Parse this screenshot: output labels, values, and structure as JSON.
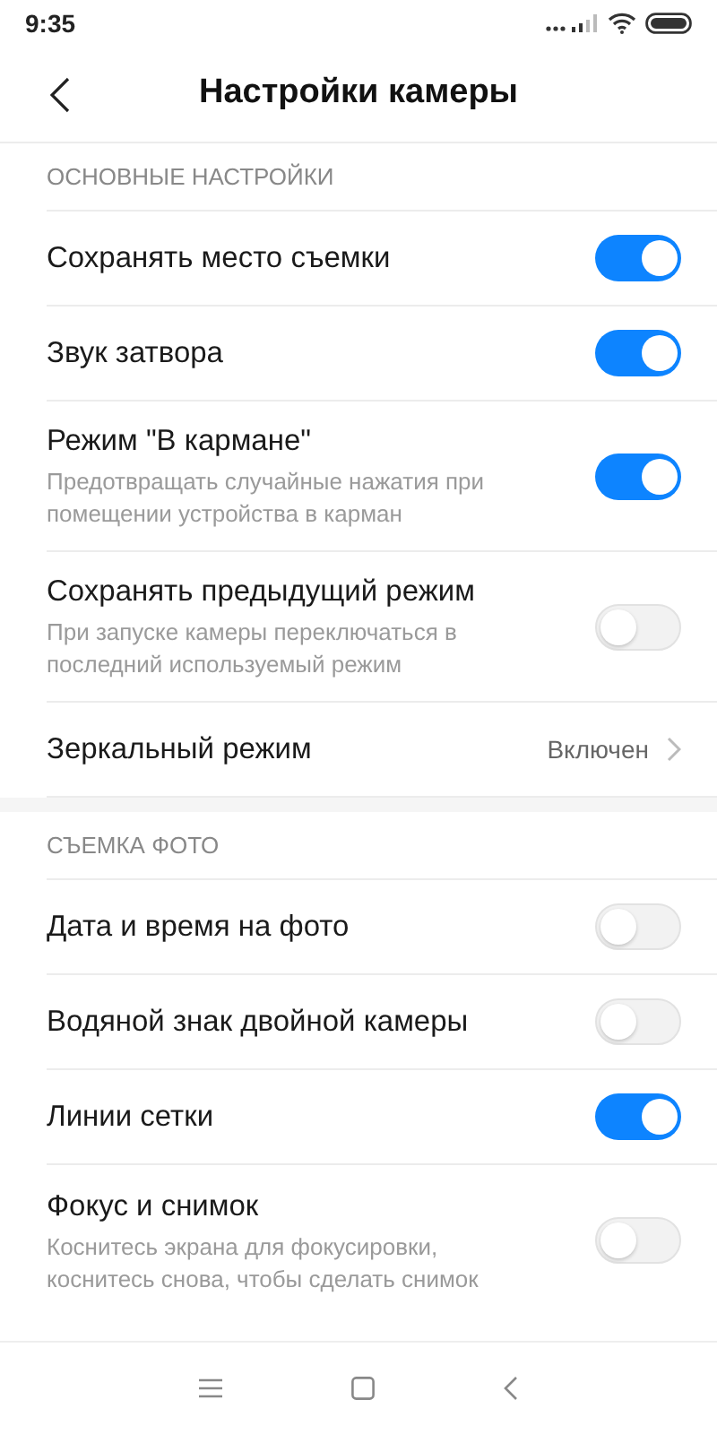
{
  "status_bar": {
    "time": "9:35"
  },
  "header": {
    "title": "Настройки камеры"
  },
  "sections": [
    {
      "title": "ОСНОВНЫЕ НАСТРОЙКИ",
      "items": [
        {
          "kind": "toggle",
          "label": "Сохранять место съемки",
          "on": true
        },
        {
          "kind": "toggle",
          "label": "Звук затвора",
          "on": true
        },
        {
          "kind": "toggle",
          "label": "Режим \"В кармане\"",
          "description": "Предотвращать случайные нажатия при помещении устройства в карман",
          "on": true
        },
        {
          "kind": "toggle",
          "label": "Сохранять предыдущий режим",
          "description": "При запуске камеры переключаться в последний используемый режим",
          "on": false
        },
        {
          "kind": "link",
          "label": "Зеркальный режим",
          "value": "Включен"
        }
      ]
    },
    {
      "title": "СЪЕМКА ФОТО",
      "items": [
        {
          "kind": "toggle",
          "label": "Дата и время на фото",
          "on": false
        },
        {
          "kind": "toggle",
          "label": "Водяной знак двойной камеры",
          "on": false
        },
        {
          "kind": "toggle",
          "label": "Линии сетки",
          "on": true
        },
        {
          "kind": "toggle",
          "label": "Фокус и снимок",
          "description": "Коснитесь экрана для фокусировки, коснитесь снова, чтобы сделать снимок",
          "on": false
        }
      ]
    }
  ]
}
